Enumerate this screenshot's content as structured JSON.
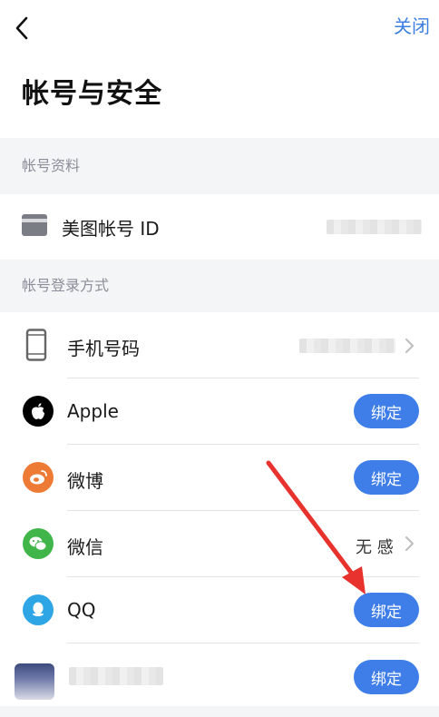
{
  "header": {
    "back_icon": "chevron-left-icon",
    "close_label": "关闭",
    "title": "帐号与安全"
  },
  "sections": {
    "profile_header": "帐号资料",
    "login_header": "帐号登录方式"
  },
  "profile": {
    "meitu_id_label": "美图帐号 ID",
    "meitu_id_icon": "id-card-icon"
  },
  "login_methods": {
    "phone": {
      "label": "手机号码",
      "icon": "phone-icon"
    },
    "apple": {
      "label": "Apple",
      "icon": "apple-icon",
      "button": "绑定"
    },
    "weibo": {
      "label": "微博",
      "icon": "weibo-icon",
      "button": "绑定"
    },
    "wechat": {
      "label": "微信",
      "icon": "wechat-icon",
      "status": "无 感"
    },
    "qq": {
      "label": "QQ",
      "icon": "qq-icon",
      "button": "绑定"
    },
    "other": {
      "button": "绑定"
    }
  },
  "colors": {
    "accent": "#3f7ee8",
    "annotation_arrow": "#e8322d",
    "weibo": "#ee7b35",
    "wechat": "#3fb54a",
    "qq": "#2ea6e6"
  }
}
